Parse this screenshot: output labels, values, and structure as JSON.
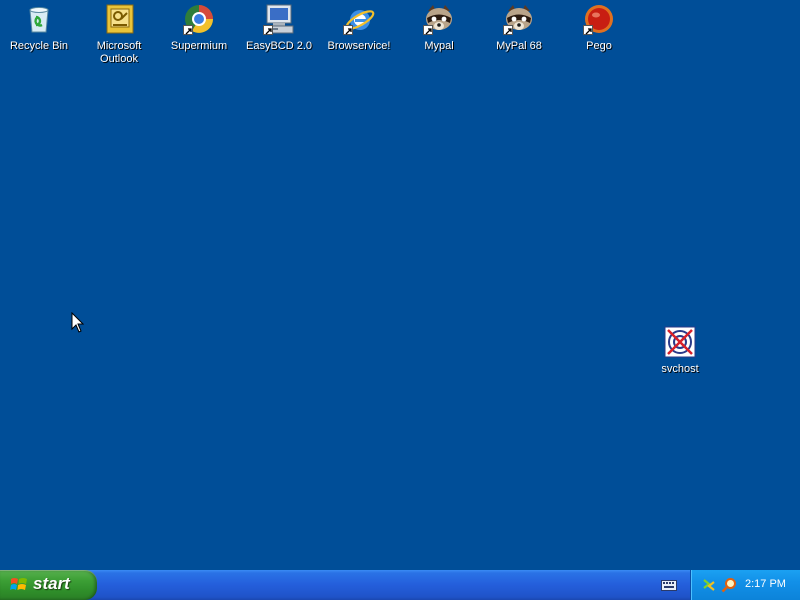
{
  "desktop": {
    "background_color": "#004e98",
    "icons": [
      {
        "label": "Recycle Bin",
        "icon": "recycle-bin-icon"
      },
      {
        "label": "Microsoft Outlook",
        "icon": "outlook-icon"
      },
      {
        "label": "Supermium",
        "icon": "supermium-icon"
      },
      {
        "label": "EasyBCD 2.0",
        "icon": "easybcd-icon"
      },
      {
        "label": "Browservice!",
        "icon": "internet-explorer-icon"
      },
      {
        "label": "Mypal",
        "icon": "mypal-icon"
      },
      {
        "label": "MyPal 68",
        "icon": "mypal-icon"
      },
      {
        "label": "Pego",
        "icon": "pego-icon"
      },
      {
        "label": "svchost",
        "icon": "svchost-icon"
      }
    ]
  },
  "taskbar": {
    "start_label": "start",
    "clock": "2:17 PM",
    "colors": {
      "taskbar_blue": "#245edb",
      "start_green": "#3c9f35",
      "tray_blue": "#1290e8"
    }
  }
}
